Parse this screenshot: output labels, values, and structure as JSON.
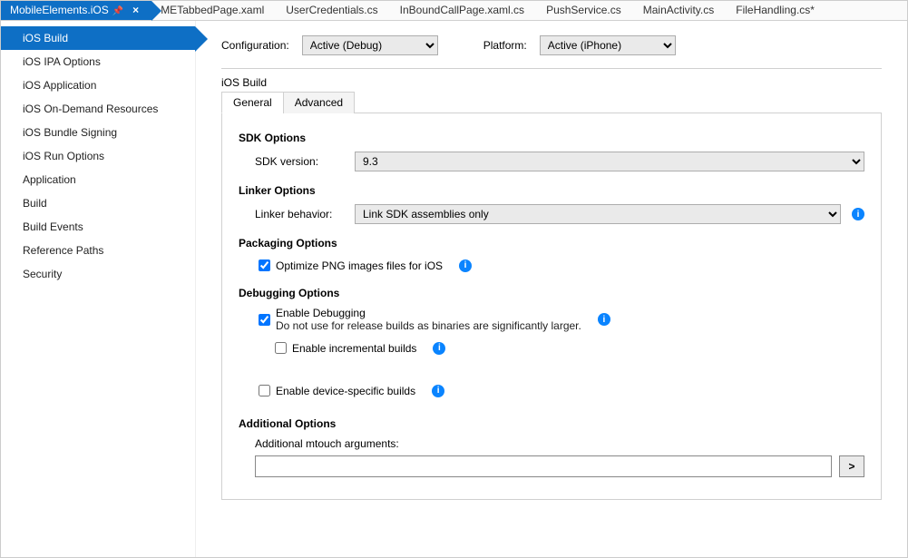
{
  "docTabs": [
    {
      "label": "MobileElements.iOS",
      "active": true,
      "pinned": true,
      "closeable": true
    },
    {
      "label": "METabbedPage.xaml"
    },
    {
      "label": "UserCredentials.cs"
    },
    {
      "label": "InBoundCallPage.xaml.cs"
    },
    {
      "label": "PushService.cs"
    },
    {
      "label": "MainActivity.cs"
    },
    {
      "label": "FileHandling.cs*"
    }
  ],
  "sidebar": {
    "items": [
      "iOS Build",
      "iOS IPA Options",
      "iOS Application",
      "iOS On-Demand Resources",
      "iOS Bundle Signing",
      "iOS Run Options",
      "Application",
      "Build",
      "Build Events",
      "Reference Paths",
      "Security"
    ],
    "activeIndex": 0
  },
  "config": {
    "configurationLabel": "Configuration:",
    "configurationValue": "Active (Debug)",
    "platformLabel": "Platform:",
    "platformValue": "Active (iPhone)"
  },
  "pageTitle": "iOS Build",
  "innerTabs": {
    "general": "General",
    "advanced": "Advanced",
    "activeIndex": 0
  },
  "sdk": {
    "title": "SDK Options",
    "versionLabel": "SDK version:",
    "versionValue": "9.3"
  },
  "linker": {
    "title": "Linker Options",
    "behaviorLabel": "Linker behavior:",
    "behaviorValue": "Link SDK assemblies only"
  },
  "packaging": {
    "title": "Packaging Options",
    "optimizePngLabel": "Optimize PNG images files for iOS",
    "optimizePngChecked": true
  },
  "debugging": {
    "title": "Debugging Options",
    "enableLabel": "Enable Debugging",
    "enableNote": "Do not use for release builds as binaries are significantly larger.",
    "enableChecked": true,
    "incrementalLabel": "Enable incremental builds",
    "incrementalChecked": false,
    "deviceSpecificLabel": "Enable device-specific builds",
    "deviceSpecificChecked": false
  },
  "additional": {
    "title": "Additional Options",
    "mtouchLabel": "Additional mtouch arguments:",
    "mtouchValue": "",
    "arrowGlyph": ">"
  },
  "infoGlyph": "i"
}
